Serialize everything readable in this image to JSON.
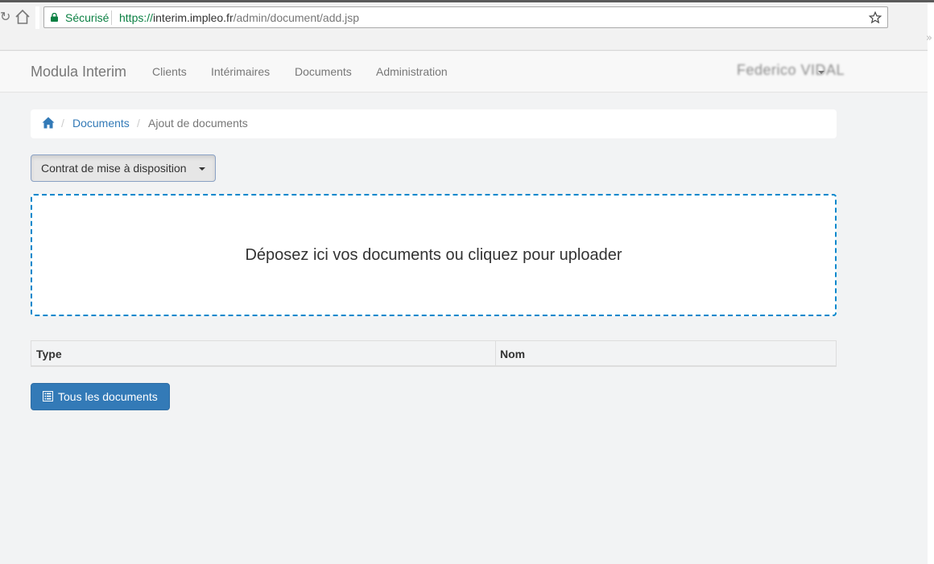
{
  "browser": {
    "secure_label": "Sécurisé",
    "url_scheme": "https://",
    "url_host": "interim.impleo.fr",
    "url_path": "/admin/document/add.jsp"
  },
  "navbar": {
    "brand": "Modula Interim",
    "items": [
      {
        "label": "Clients"
      },
      {
        "label": "Intérimaires"
      },
      {
        "label": "Documents"
      },
      {
        "label": "Administration"
      }
    ],
    "user": "Federico VIDAL"
  },
  "breadcrumb": {
    "separator": "/",
    "link": "Documents",
    "current": "Ajout de documents"
  },
  "document_type_select": {
    "selected": "Contrat de mise à disposition"
  },
  "dropzone": {
    "message": "Déposez ici vos documents ou cliquez pour uploader"
  },
  "table": {
    "columns": [
      "Type",
      "Nom"
    ]
  },
  "actions": {
    "all_documents": "Tous les documents"
  },
  "colors": {
    "primary": "#337ab7",
    "dropzone_border": "#0087cc",
    "secure_green": "#0b8043"
  }
}
